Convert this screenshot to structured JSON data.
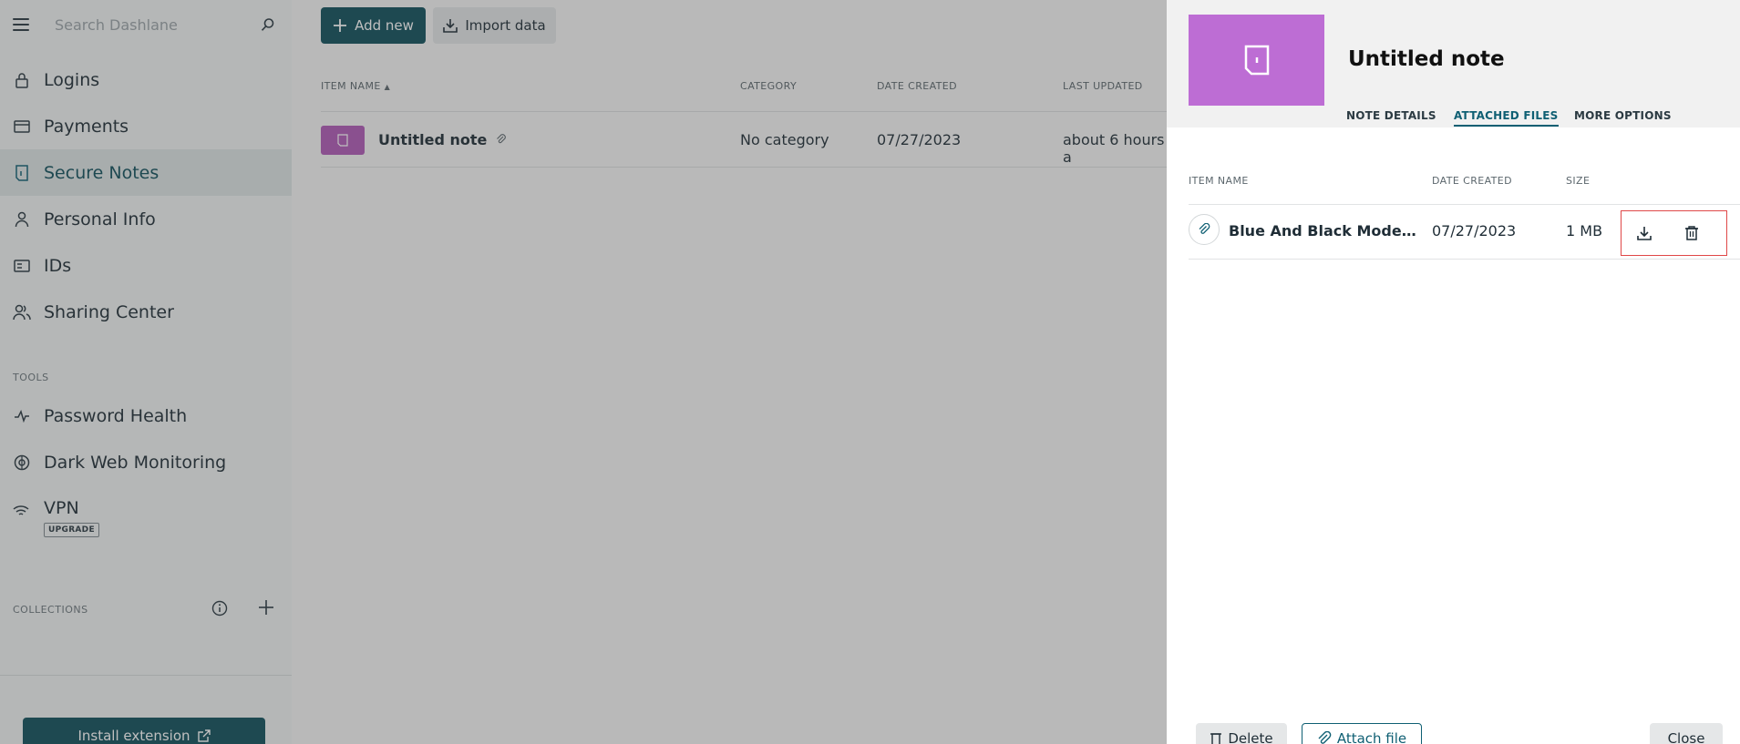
{
  "sidebar": {
    "search_placeholder": "Search Dashlane",
    "nav": [
      {
        "label": "Logins",
        "icon": "lock-icon"
      },
      {
        "label": "Payments",
        "icon": "credit-card-icon"
      },
      {
        "label": "Secure Notes",
        "icon": "note-icon"
      },
      {
        "label": "Personal Info",
        "icon": "person-icon"
      },
      {
        "label": "IDs",
        "icon": "id-card-icon"
      },
      {
        "label": "Sharing Center",
        "icon": "sharing-icon"
      }
    ],
    "tools_label": "TOOLS",
    "tools": [
      {
        "label": "Password Health",
        "icon": "pulse-icon"
      },
      {
        "label": "Dark Web Monitoring",
        "icon": "radar-icon"
      }
    ],
    "vpn": {
      "label": "VPN",
      "badge": "UPGRADE",
      "icon": "wifi-icon"
    },
    "collections_label": "COLLECTIONS",
    "install_label": "Install extension"
  },
  "main": {
    "add_label": "Add new",
    "import_label": "Import data",
    "columns": [
      "ITEM NAME",
      "CATEGORY",
      "DATE CREATED",
      "LAST UPDATED"
    ],
    "rows": [
      {
        "title": "Untitled note",
        "category": "No category",
        "date_created": "07/27/2023",
        "last_updated": "about 6 hours a"
      }
    ]
  },
  "panel": {
    "title": "Untitled note",
    "tabs": [
      "NOTE DETAILS",
      "ATTACHED FILES",
      "MORE OPTIONS"
    ],
    "active_tab": "ATTACHED FILES",
    "columns": [
      "ITEM NAME",
      "DATE CREATED",
      "SIZE"
    ],
    "files": [
      {
        "name": "Blue And Black Modern Pr...",
        "date_created": "07/27/2023",
        "size": "1 MB"
      }
    ],
    "delete_label": "Delete",
    "attach_label": "Attach file",
    "close_label": "Close"
  },
  "colors": {
    "accent": "#0f4f5c",
    "note_purple": "#bd6dd4",
    "highlight_red": "#e04848"
  }
}
